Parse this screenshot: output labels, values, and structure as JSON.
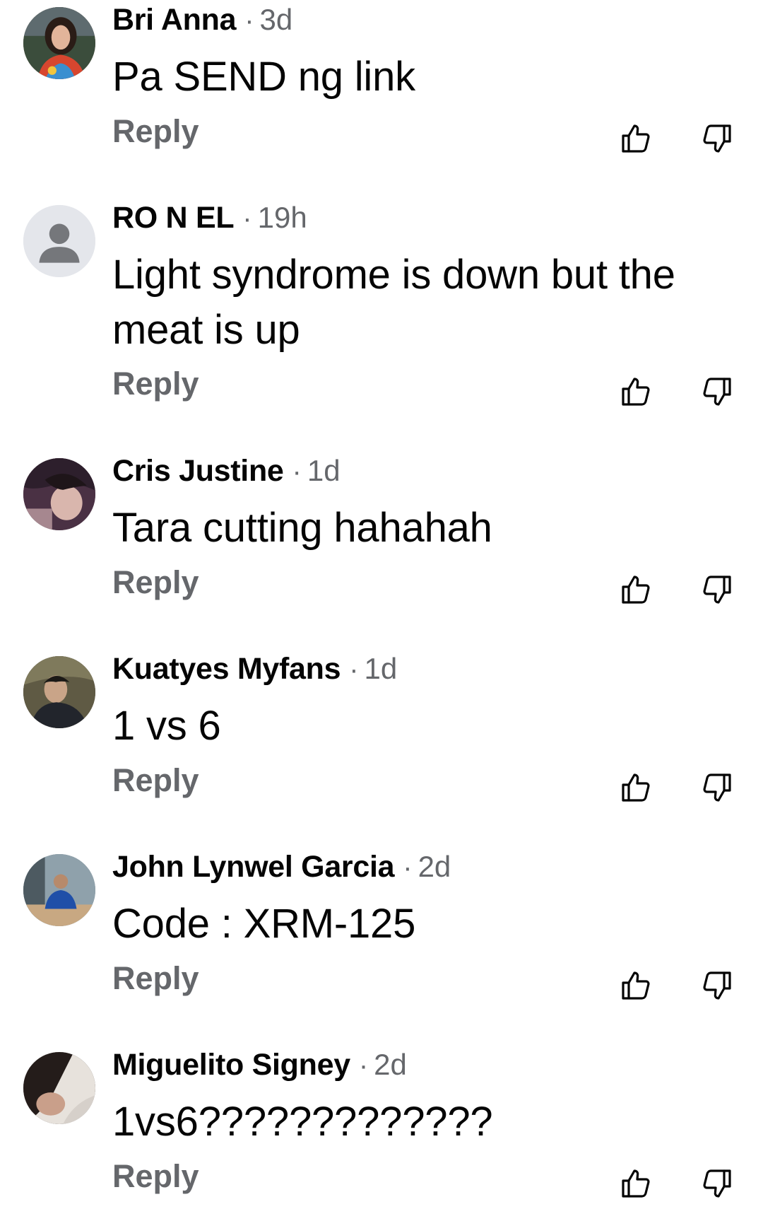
{
  "ui": {
    "dot": "·",
    "reply_label": "Reply",
    "like_icon": "thumbs-up-outline",
    "dislike_icon": "thumbs-down-outline",
    "meta_color": "#65676b",
    "text_color": "#050505"
  },
  "comments": [
    {
      "author": "Bri Anna",
      "time": "3d",
      "text": "Pa SEND ng link"
    },
    {
      "author": "RO N EL",
      "time": "19h",
      "text": "Light syndrome is down but the meat is up"
    },
    {
      "author": "Cris Justine",
      "time": "1d",
      "text": "Tara cutting hahahah"
    },
    {
      "author": "Kuatyes Myfans",
      "time": "1d",
      "text": "1 vs 6"
    },
    {
      "author": "John Lynwel Garcia",
      "time": "2d",
      "text": "Code : XRM-125"
    },
    {
      "author": "Miguelito Signey",
      "time": "2d",
      "text": "1vs6?????????????"
    }
  ]
}
